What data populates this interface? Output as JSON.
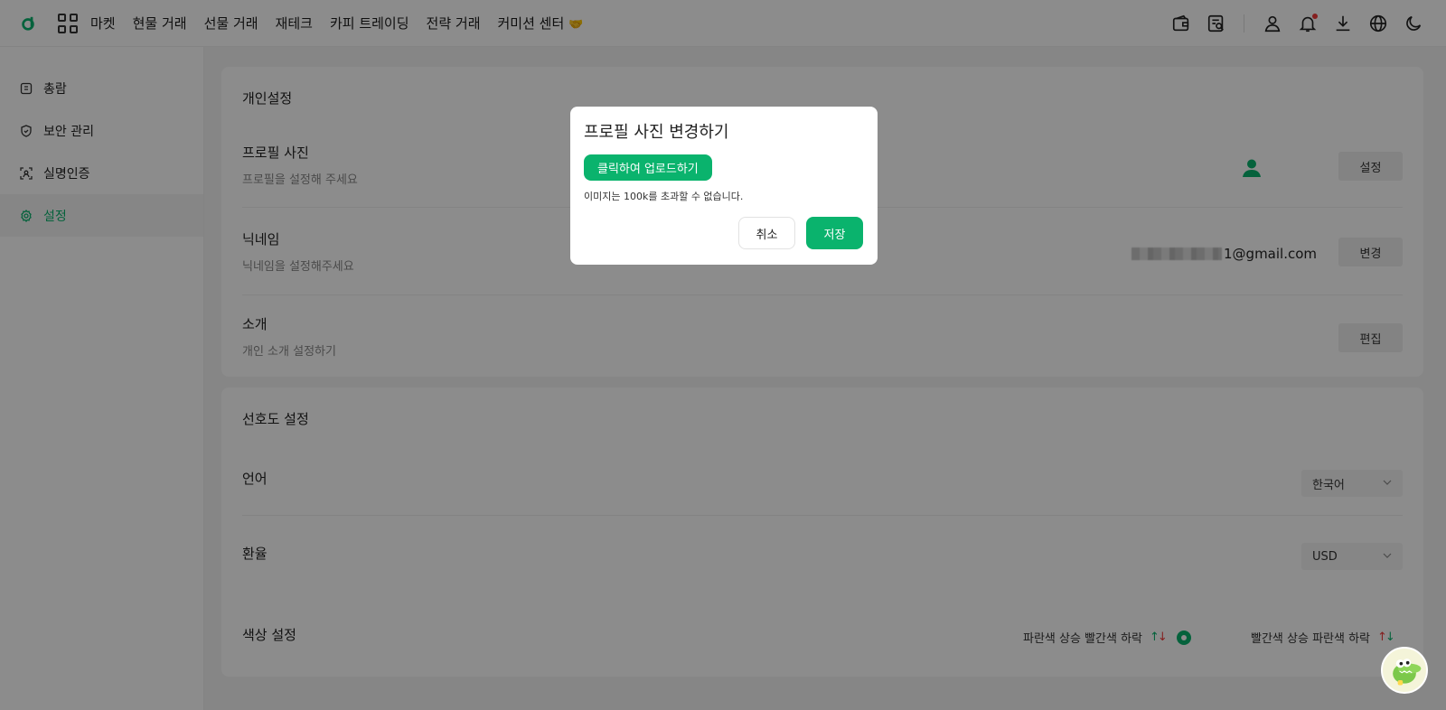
{
  "topbar": {
    "nav_items": [
      "마켓",
      "현물 거래",
      "선물 거래",
      "재테크",
      "카피 트레이딩",
      "전략 거래",
      "커미션 센터"
    ],
    "commission_emoji": "🤝"
  },
  "sidebar": {
    "items": [
      {
        "label": "총람",
        "icon": "overview-icon"
      },
      {
        "label": "보안 관리",
        "icon": "shield-icon"
      },
      {
        "label": "실명인증",
        "icon": "id-scan-icon"
      },
      {
        "label": "설정",
        "icon": "gear-icon",
        "active": true
      }
    ]
  },
  "personal": {
    "title": "개인설정",
    "profile_title": "프로필 사진",
    "profile_sub": "프로필을 설정해 주세요",
    "profile_btn": "설정",
    "nickname_title": "닉네임",
    "nickname_sub": "닉네임을 설정해주세요",
    "nickname_value": "1@gmail.com",
    "nickname_btn": "변경",
    "intro_title": "소개",
    "intro_sub": "개인 소개 설정하기",
    "intro_btn": "편집"
  },
  "preference": {
    "title": "선호도 설정",
    "language_label": "언어",
    "language_value": "한국어",
    "rate_label": "환율",
    "rate_value": "USD",
    "color_label": "색상 설정",
    "color_opt1": "파란색 상승 빨간색 하락",
    "color_opt2": "빨간색 상승 파란색 하락"
  },
  "modal": {
    "title": "프로필 사진 변경하기",
    "upload_label": "클릭하여 업로드하기",
    "note": "이미지는 100k를 초과할 수 없습니다.",
    "cancel_label": "취소",
    "save_label": "저장"
  },
  "colors": {
    "accent": "#0ab36d",
    "up_green": "#0ab36d",
    "down_red": "#f23a3a",
    "overlay": "rgba(0,0,0,0.45)"
  }
}
